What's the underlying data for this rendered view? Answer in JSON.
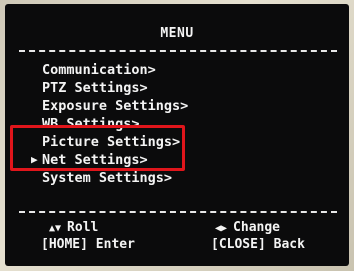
{
  "menu": {
    "title": "MENU",
    "items": [
      {
        "label": "Communication>"
      },
      {
        "label": "PTZ Settings>"
      },
      {
        "label": "Exposure Settings>"
      },
      {
        "label": "WB Settings>"
      },
      {
        "label": "Picture Settings>"
      },
      {
        "label": "Net Settings>"
      },
      {
        "label": "System Settings>"
      }
    ],
    "selected_index": 5,
    "cursor_glyph": "▶"
  },
  "hints": {
    "roll_icon": "▲▼",
    "roll_label": "Roll",
    "change_icon": "◀▶",
    "change_label": "Change",
    "enter_label": "[HOME] Enter",
    "back_label": "[CLOSE] Back"
  },
  "colors": {
    "screen_bg": "#0b0b0c",
    "text": "#f4f4f4",
    "highlight_border": "#e0151b"
  }
}
